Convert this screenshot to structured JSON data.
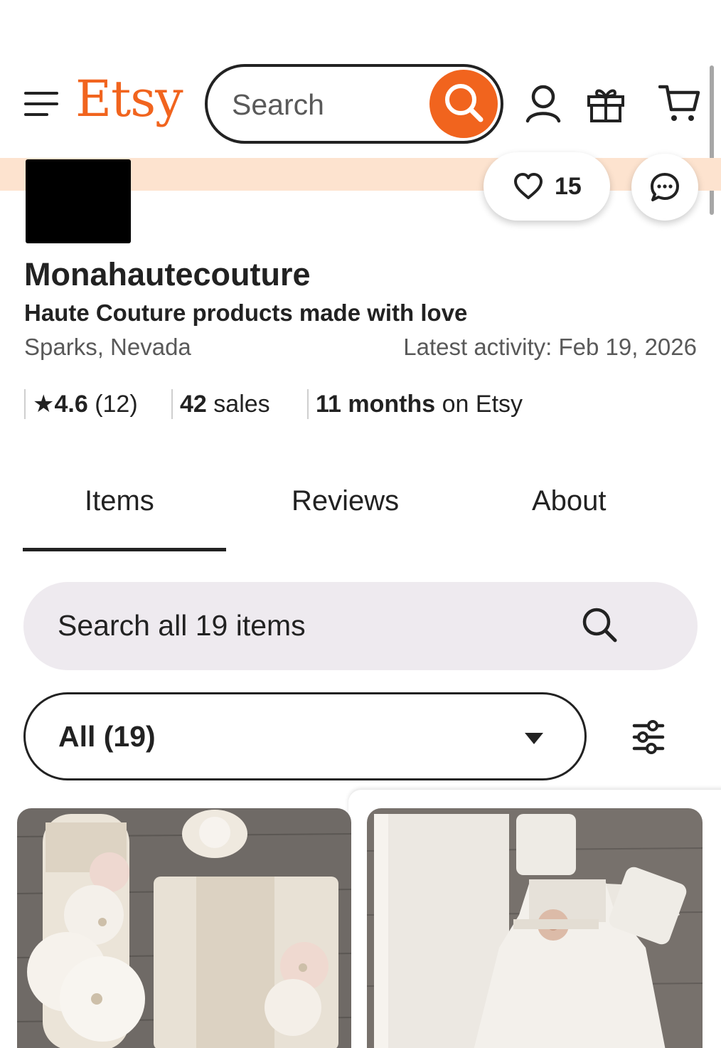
{
  "header": {
    "logo": "Etsy",
    "search_placeholder": "Search",
    "icons": [
      "menu-icon",
      "search-icon",
      "account-icon",
      "gift-icon",
      "cart-icon"
    ]
  },
  "shop": {
    "favorites_count": "15",
    "name": "Monahautecouture",
    "tagline": "Haute Couture products made with love",
    "location": "Sparks, Nevada",
    "latest_activity": "Latest activity: Feb 19, 2026",
    "rating_value": "4.6",
    "rating_count": "(12)",
    "sales_count": "42",
    "sales_label": "sales",
    "tenure_value": "11 months",
    "tenure_label": "on Etsy"
  },
  "tabs": [
    {
      "label": "Items",
      "active": true
    },
    {
      "label": "Reviews",
      "active": false
    },
    {
      "label": "About",
      "active": false
    }
  ],
  "item_search": {
    "placeholder": "Search all 19 items"
  },
  "category_filter": {
    "selected": "All (19)"
  },
  "listings": [
    {
      "image": "lace candle and guest book set with white flowers"
    },
    {
      "image": "white lace christening gown with blush flower"
    }
  ],
  "colors": {
    "brand_orange": "#F1641E",
    "banner_peach": "#FDE3CF",
    "search_fill": "#EEEAEF",
    "text": "#222222",
    "muted_text": "#595959"
  }
}
